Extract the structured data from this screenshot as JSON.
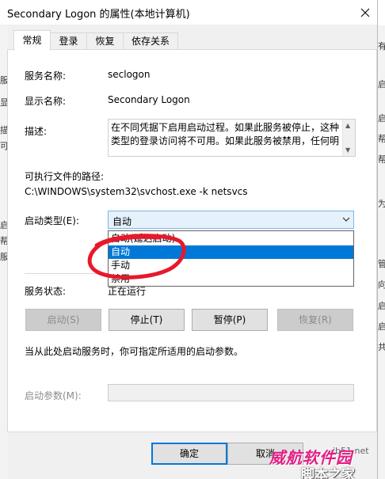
{
  "window": {
    "title": "Secondary Logon 的属性(本地计算机)",
    "close_icon": "close-icon"
  },
  "tabs": [
    {
      "label": "常规",
      "active": true
    },
    {
      "label": "登录",
      "active": false
    },
    {
      "label": "恢复",
      "active": false
    },
    {
      "label": "依存关系",
      "active": false
    }
  ],
  "general": {
    "service_name_label": "服务名称:",
    "service_name": "seclogon",
    "display_name_label": "显示名称:",
    "display_name": "Secondary Logon",
    "description_label": "描述:",
    "description": "在不同凭据下启用启动过程。如果此服务被停止，这种类型的登录访问将不可用。如果此服务被禁用，任何明",
    "exe_path_label": "可执行文件的路径:",
    "exe_path": "C:\\WINDOWS\\system32\\svchost.exe -k netsvcs",
    "startup_type_label": "启动类型(E):",
    "startup_type_value": "自动",
    "startup_options": [
      "自动(延迟启动)",
      "自动",
      "手动",
      "禁用"
    ],
    "startup_selected_index": 1,
    "service_status_label": "服务状态:",
    "service_status": "正在运行",
    "hint": "当从此处启动服务时，你可指定所适用的启动参数。",
    "start_params_label": "启动参数(M):",
    "start_params_value": ""
  },
  "service_buttons": {
    "start": "启动(S)",
    "stop": "停止(T)",
    "pause": "暂停(P)",
    "resume": "恢复(R)"
  },
  "footer": {
    "ok": "确定",
    "cancel": "取消"
  },
  "background": {
    "left_chars": [
      "服",
      "显",
      "描",
      "可",
      "启",
      "帮",
      "服"
    ],
    "right_chars": [
      "有",
      "启",
      "启",
      "帮",
      "帮",
      "为",
      "管",
      "向",
      "启",
      "启",
      "共"
    ]
  },
  "watermark": {
    "main": "威航软件园",
    "sub": "脚本之家",
    "site": "jb51.net"
  },
  "colors": {
    "accent": "#0078d7",
    "annotation_red": "#e8182a",
    "watermark_pink": "#e21f86"
  }
}
